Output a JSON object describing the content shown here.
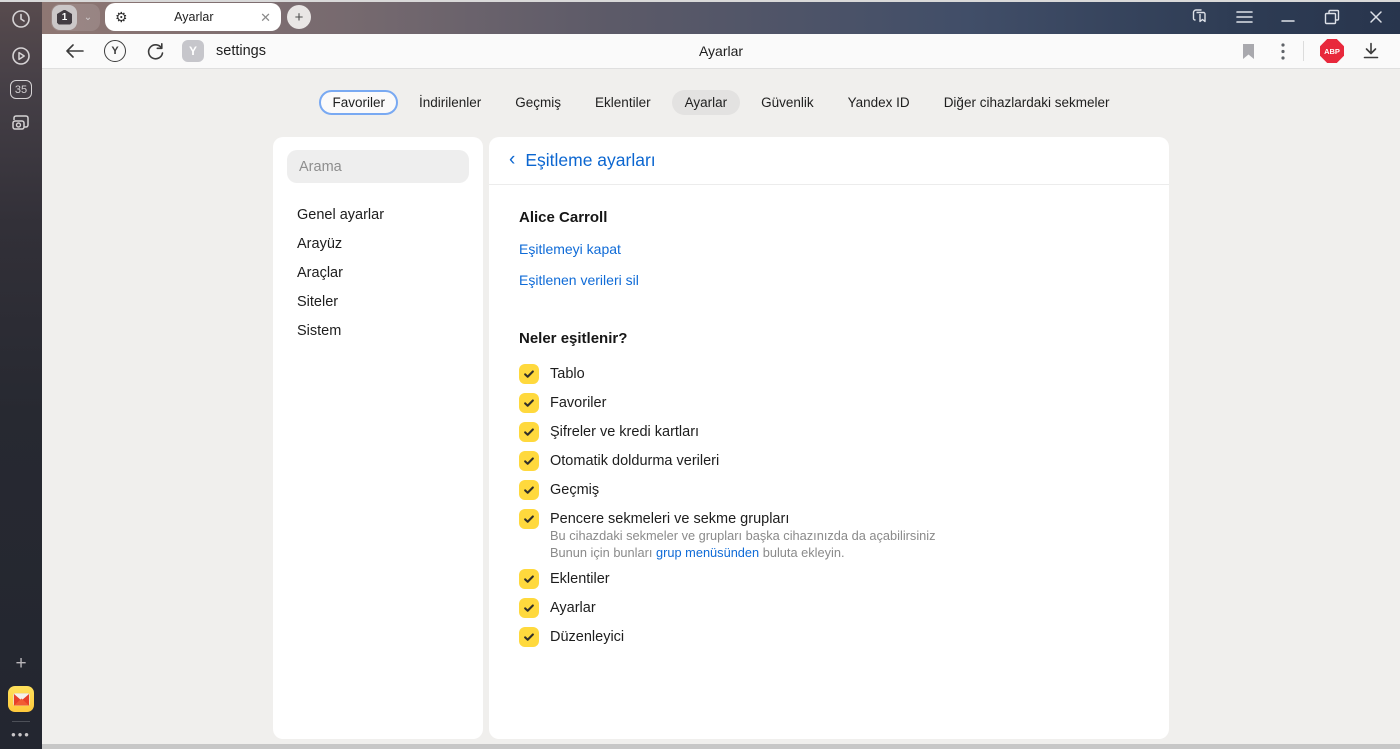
{
  "titlebar": {
    "tab_group_count": "1",
    "active_tab": {
      "title": "Ayarlar"
    }
  },
  "addressbar": {
    "url_text": "settings",
    "favicon_letter": "Y",
    "protocol_letter": "Y",
    "page_title": "Ayarlar",
    "adblock_label": "ABP"
  },
  "side_rail": {
    "counter_badge": "35"
  },
  "nav_tabs": [
    {
      "label": "Favoriler",
      "state": "focused"
    },
    {
      "label": "İndirilenler",
      "state": "normal"
    },
    {
      "label": "Geçmiş",
      "state": "normal"
    },
    {
      "label": "Eklentiler",
      "state": "normal"
    },
    {
      "label": "Ayarlar",
      "state": "active"
    },
    {
      "label": "Güvenlik",
      "state": "normal"
    },
    {
      "label": "Yandex ID",
      "state": "normal"
    },
    {
      "label": "Diğer cihazlardaki sekmeler",
      "state": "normal"
    }
  ],
  "settings_menu": {
    "search_placeholder": "Arama",
    "items": [
      "Genel ayarlar",
      "Arayüz",
      "Araçlar",
      "Siteler",
      "Sistem"
    ]
  },
  "sync": {
    "title": "Eşitleme ayarları",
    "account_name": "Alice Carroll",
    "link_disable": "Eşitlemeyi kapat",
    "link_delete": "Eşitlenen verileri sil",
    "section_title": "Neler eşitlenir?",
    "items": [
      {
        "label": "Tablo",
        "checked": true
      },
      {
        "label": "Favoriler",
        "checked": true
      },
      {
        "label": "Şifreler ve kredi kartları",
        "checked": true
      },
      {
        "label": "Otomatik doldurma verileri",
        "checked": true
      },
      {
        "label": "Geçmiş",
        "checked": true
      },
      {
        "label": "Pencere sekmeleri ve sekme grupları",
        "checked": true,
        "description_line1": "Bu cihazdaki sekmeler ve grupları başka cihazınızda da açabilirsiniz",
        "description_line2_prefix": "Bunun için bunları ",
        "description_link": "grup menüsünden",
        "description_line2_suffix": " buluta ekleyin."
      },
      {
        "label": "Eklentiler",
        "checked": true
      },
      {
        "label": "Ayarlar",
        "checked": true
      },
      {
        "label": "Düzenleyici",
        "checked": true
      }
    ]
  },
  "colors": {
    "accent_blue": "#0f6bd7",
    "checkbox_yellow": "#ffd93d",
    "adblock_red": "#e8283c",
    "titlebar_left": "#8e7773",
    "titlebar_right": "#28354d"
  }
}
